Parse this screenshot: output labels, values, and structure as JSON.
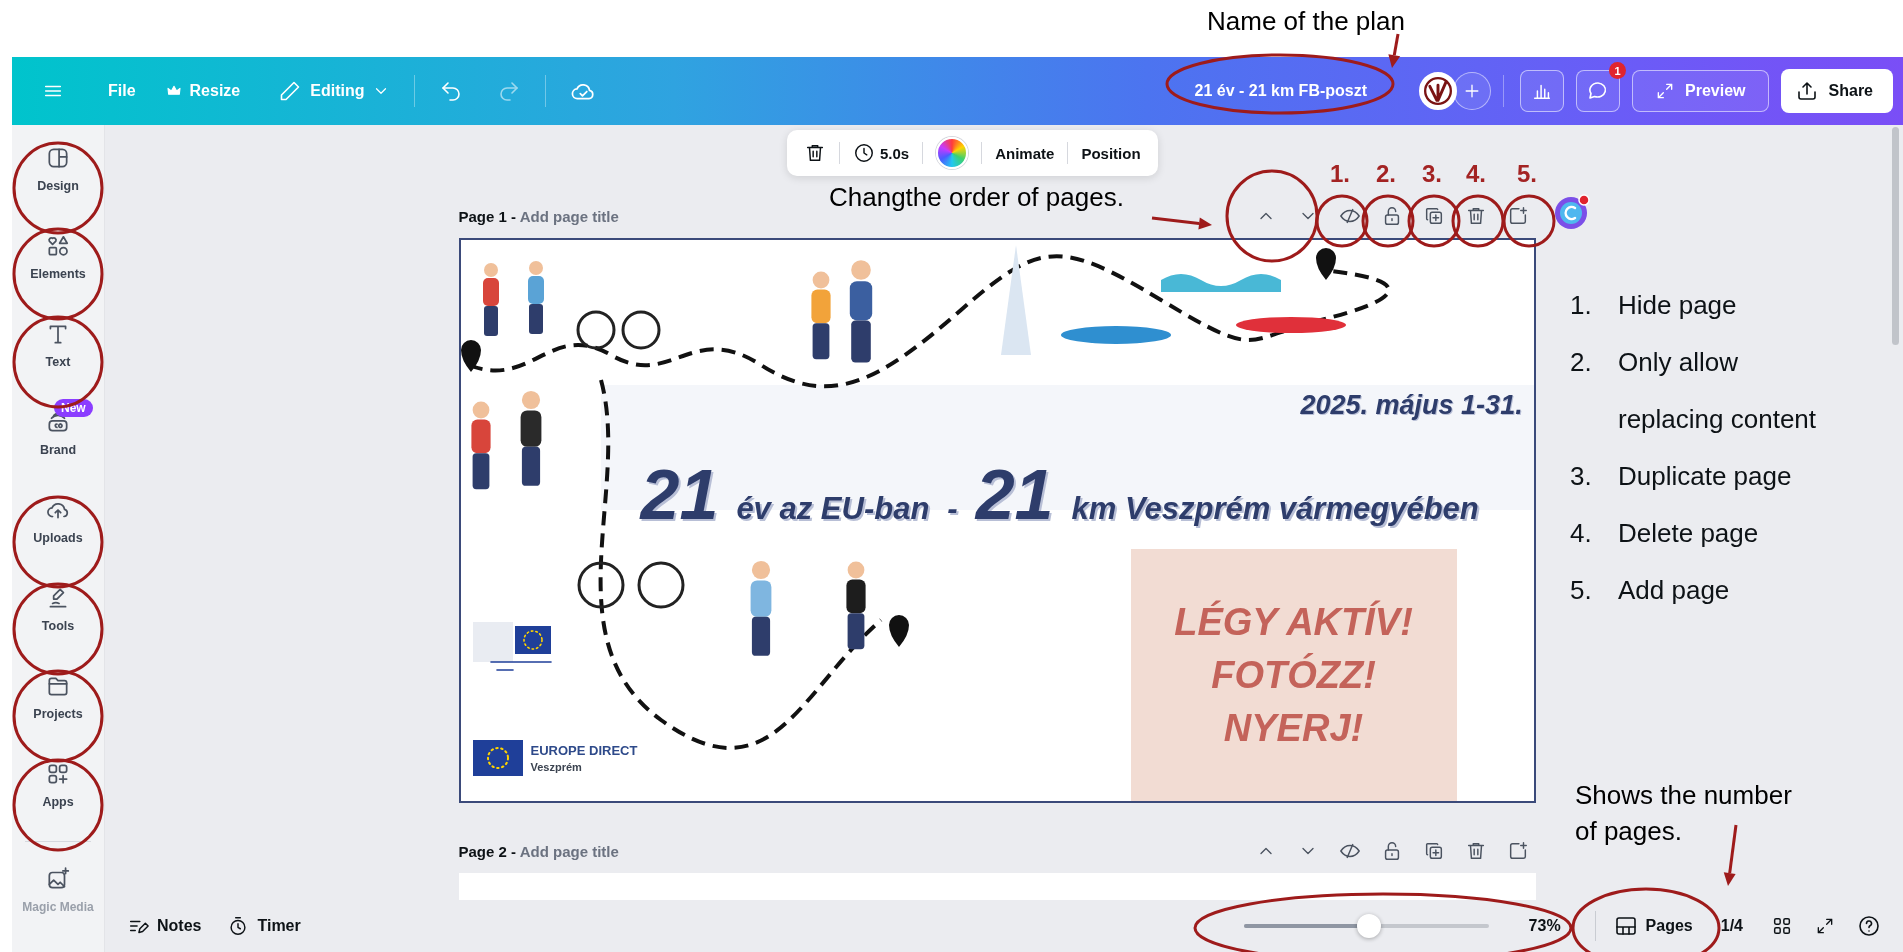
{
  "topbar": {
    "file": "File",
    "resize": "Resize",
    "mode": "Editing",
    "title": "21 év - 21 km FB-poszt",
    "comment_badge": "1",
    "preview": "Preview",
    "share": "Share"
  },
  "sidebar": [
    {
      "label": "Design"
    },
    {
      "label": "Elements"
    },
    {
      "label": "Text"
    },
    {
      "label": "Brand",
      "badge": "New"
    },
    {
      "label": "Uploads"
    },
    {
      "label": "Tools"
    },
    {
      "label": "Projects"
    },
    {
      "label": "Apps"
    }
  ],
  "sidebar_bottom": {
    "label": "Magic Media"
  },
  "toolbar": {
    "duration": "5.0s",
    "animate": "Animate",
    "position": "Position"
  },
  "pages": [
    {
      "label": "Page 1 -",
      "title_placeholder": "Add page title"
    },
    {
      "label": "Page 2 -",
      "title_placeholder": "Add page title"
    }
  ],
  "poster": {
    "date": "2025. május 1-31.",
    "headline": [
      {
        "kind": "big",
        "text": "21"
      },
      {
        "kind": "small",
        "text": "év az EU-ban"
      },
      {
        "kind": "small",
        "text": "-"
      },
      {
        "kind": "big",
        "text": "21"
      },
      {
        "kind": "small",
        "text": "km Veszprém vármegyében"
      }
    ],
    "cta": [
      "LÉGY AKTÍV!",
      "FOTÓZZ!",
      "NYERJ!"
    ],
    "org": {
      "name": "EUROPE DIRECT",
      "city": "Veszprém"
    }
  },
  "bottom_bar": {
    "notes": "Notes",
    "timer": "Timer",
    "zoom": {
      "level": 0.51,
      "reading": "73%"
    },
    "pages": "Pages",
    "page_count": "1/4"
  },
  "annotations": {
    "plan_name": "Name of the plan",
    "order_note": "Changthe order of pages.",
    "numbers": [
      "1.",
      "2.",
      "3.",
      "4.",
      "5."
    ],
    "legend": [
      {
        "number": "1.",
        "text": "Hide page"
      },
      {
        "number": "2.",
        "text": "Only allow replacing content"
      },
      {
        "number": "3.",
        "text": "Duplicate page"
      },
      {
        "number": "4.",
        "text": "Delete page"
      },
      {
        "number": "5.",
        "text": "Add page"
      }
    ],
    "pages_note": "Shows the number of pages."
  }
}
